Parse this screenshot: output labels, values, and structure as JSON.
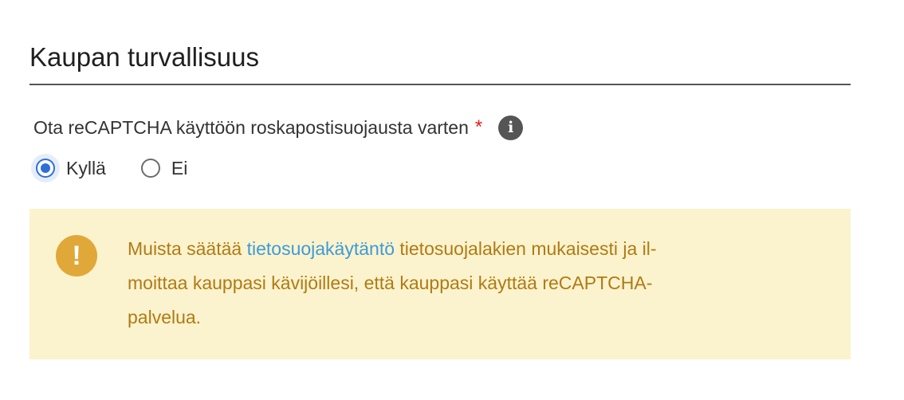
{
  "section": {
    "title": "Kaupan turvallisuus"
  },
  "recaptcha_field": {
    "label": "Ota reCAPTCHA käyttöön roskapostisuojausta varten",
    "required_marker": "*",
    "info_icon": "info-icon",
    "options": [
      {
        "label": "Kyllä",
        "selected": true
      },
      {
        "label": "Ei",
        "selected": false
      }
    ]
  },
  "alert": {
    "icon": "exclamation-icon",
    "line1_before": "Muista säätää",
    "link_text": "tietosuojakäytäntö",
    "line1_after": "tietosuojalakien mukaisesti ja il-",
    "line2": "moittaa kauppasi kävijöillesi, että kauppasi käyttää reCAPTCHA-",
    "line3": "palvelua."
  },
  "colors": {
    "accent": "#2f6fd8",
    "required": "#e11d1d",
    "warning_bg": "#fbf3cd",
    "warning_text": "#b07a15",
    "warning_icon": "#e0a838",
    "link": "#3f9ad8"
  }
}
